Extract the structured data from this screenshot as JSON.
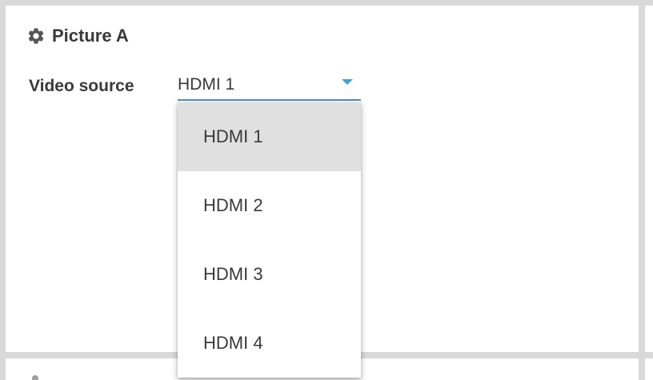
{
  "panel": {
    "title": "Picture A",
    "title_icon": "gear-icon"
  },
  "video_source": {
    "label": "Video source",
    "selected_value": "HDMI 1",
    "options": [
      "HDMI 1",
      "HDMI 2",
      "HDMI 3",
      "HDMI 4"
    ],
    "selected_index": 0
  },
  "colors": {
    "accent": "#3aa0e4",
    "underline": "#4a90c8",
    "selected_option_bg": "#e0e0e0",
    "text": "#3a3a3a",
    "divider": "#d9d9d9"
  }
}
